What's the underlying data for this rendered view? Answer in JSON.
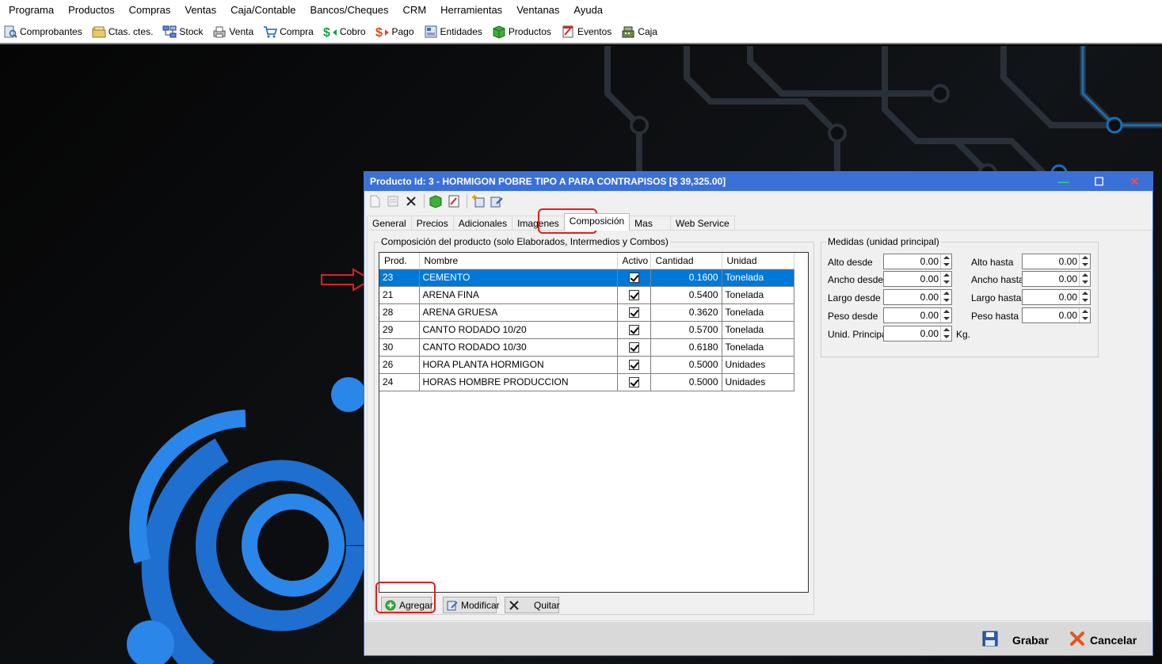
{
  "menu": [
    "Programa",
    "Productos",
    "Compras",
    "Ventas",
    "Caja/Contable",
    "Bancos/Cheques",
    "CRM",
    "Herramientas",
    "Ventanas",
    "Ayuda"
  ],
  "toolbar": [
    {
      "label": "Comprobantes",
      "icon": "document-search-icon"
    },
    {
      "label": "Ctas. ctes.",
      "icon": "folder-icon"
    },
    {
      "label": "Stock",
      "icon": "network-icon"
    },
    {
      "label": "Venta",
      "icon": "printer-icon"
    },
    {
      "label": "Compra",
      "icon": "cart-icon"
    },
    {
      "label": "Cobro",
      "icon": "dollar-in-icon"
    },
    {
      "label": "Pago",
      "icon": "dollar-out-icon"
    },
    {
      "label": "Entidades",
      "icon": "contacts-icon"
    },
    {
      "label": "Productos",
      "icon": "box-icon"
    },
    {
      "label": "Eventos",
      "icon": "calendar-icon"
    },
    {
      "label": "Caja",
      "icon": "cash-register-icon"
    }
  ],
  "window": {
    "title": "Producto Id: 3 - HORMIGON POBRE TIPO A PARA CONTRAPISOS [$ 39,325.00]",
    "minimize": "—",
    "maximize": "☐",
    "close": "✕"
  },
  "tabs": [
    "General",
    "Precios",
    "Adicionales",
    "Imagenes",
    "Composición",
    "Mas",
    "Web Service"
  ],
  "active_tab": "Composición",
  "composition": {
    "legend": "Composición del producto (solo Elaborados, Intermedios y Combos)",
    "columns": [
      "Prod.",
      "Nombre",
      "Activo",
      "Cantidad",
      "Unidad"
    ],
    "rows": [
      {
        "prod": "23",
        "nombre": "CEMENTO",
        "activo": true,
        "cantidad": "0.1600",
        "unidad": "Tonelada"
      },
      {
        "prod": "21",
        "nombre": "ARENA FINA",
        "activo": true,
        "cantidad": "0.5400",
        "unidad": "Tonelada"
      },
      {
        "prod": "28",
        "nombre": "ARENA GRUESA",
        "activo": true,
        "cantidad": "0.3620",
        "unidad": "Tonelada"
      },
      {
        "prod": "29",
        "nombre": "CANTO RODADO 10/20",
        "activo": true,
        "cantidad": "0.5700",
        "unidad": "Tonelada"
      },
      {
        "prod": "30",
        "nombre": "CANTO RODADO 10/30",
        "activo": true,
        "cantidad": "0.6180",
        "unidad": "Tonelada"
      },
      {
        "prod": "26",
        "nombre": "HORA PLANTA HORMIGON",
        "activo": true,
        "cantidad": "0.5000",
        "unidad": "Unidades"
      },
      {
        "prod": "24",
        "nombre": "HORAS HOMBRE PRODUCCION",
        "activo": true,
        "cantidad": "0.5000",
        "unidad": "Unidades"
      }
    ],
    "buttons": {
      "add": "Agregar",
      "modify": "Modificar",
      "remove": "Quitar"
    }
  },
  "medidas": {
    "legend": "Medidas (unidad principal)",
    "alto_desde": {
      "label": "Alto desde",
      "value": "0.00"
    },
    "ancho_desde": {
      "label": "Ancho desde",
      "value": "0.00"
    },
    "largo_desde": {
      "label": "Largo desde",
      "value": "0.00"
    },
    "peso_desde": {
      "label": "Peso desde",
      "value": "0.00"
    },
    "unid_principal": {
      "label": "Unid. Principal",
      "value": "0.00",
      "unit": "Kg."
    },
    "alto_hasta": {
      "label": "Alto hasta",
      "value": "0.00"
    },
    "ancho_hasta": {
      "label": "Ancho hasta",
      "value": "0.00"
    },
    "largo_hasta": {
      "label": "Largo hasta",
      "value": "0.00"
    },
    "peso_hasta": {
      "label": "Peso hasta",
      "value": "0.00"
    }
  },
  "footer": {
    "save": "Grabar",
    "cancel": "Cancelar"
  },
  "colors": {
    "titlebar": "#3b70d8",
    "selection": "#0078d7",
    "highlight": "#e02020"
  }
}
